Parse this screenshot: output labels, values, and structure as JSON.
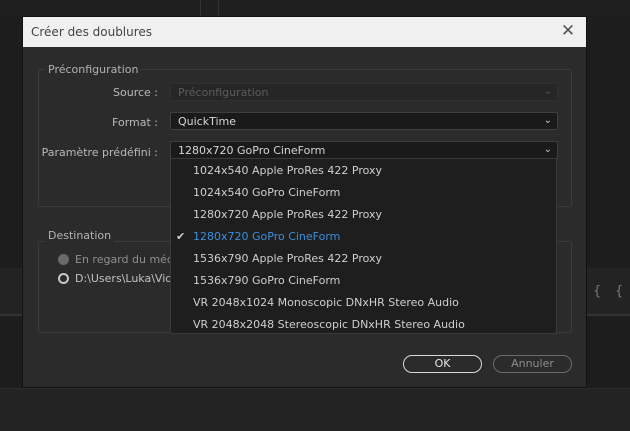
{
  "dialog": {
    "title": "Créer des doublures",
    "close_glyph": "✕"
  },
  "preconfig": {
    "legend": "Préconfiguration",
    "source_label": "Source :",
    "source_value": "Préconfiguration",
    "format_label": "Format :",
    "format_value": "QuickTime",
    "preset_label": "Paramètre prédéfini :",
    "preset_value": "1280x720 GoPro CineForm"
  },
  "dropdown": {
    "options": [
      {
        "label": "1024x540 Apple ProRes 422 Proxy",
        "selected": false
      },
      {
        "label": "1024x540 GoPro CineForm",
        "selected": false
      },
      {
        "label": "1280x720 Apple ProRes 422 Proxy",
        "selected": false
      },
      {
        "label": "1280x720 GoPro CineForm",
        "selected": true
      },
      {
        "label": "1536x790 Apple ProRes 422 Proxy",
        "selected": false
      },
      {
        "label": "1536x790 GoPro CineForm",
        "selected": false
      },
      {
        "label": "VR 2048x1024 Monoscopic DNxHR Stereo Audio",
        "selected": false
      },
      {
        "label": "VR 2048x2048 Stereoscopic DNxHR Stereo Audio",
        "selected": false
      }
    ],
    "check_glyph": "✔"
  },
  "destination": {
    "legend": "Destination",
    "option_beside_media": "En regard du média",
    "option_path": "D:\\Users\\Luka\\Vidé"
  },
  "buttons": {
    "ok": "OK",
    "cancel": "Annuler"
  },
  "icons": {
    "chevron": "⌄",
    "bg_brace": "{"
  },
  "colors": {
    "accent": "#3b8fe0",
    "dialog_bg": "#2b2b2b",
    "titlebar_bg": "#f0f0f0"
  }
}
